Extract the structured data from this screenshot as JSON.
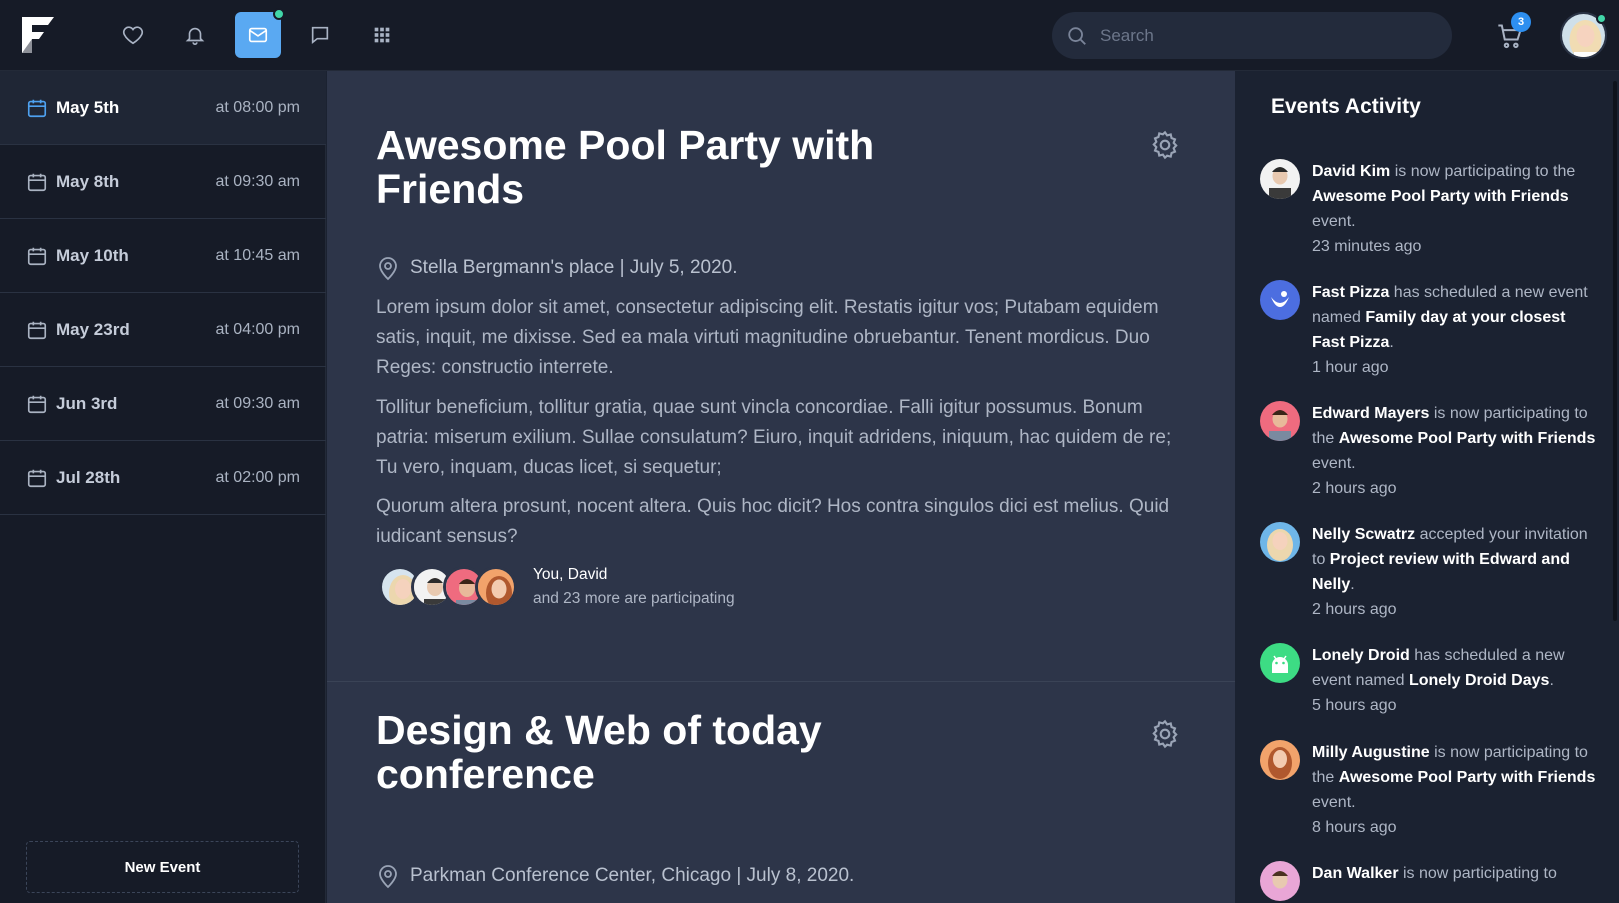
{
  "header": {
    "search_placeholder": "Search",
    "cart_count": "3"
  },
  "sidebar": {
    "dates": [
      {
        "label": "May 5th",
        "time": "at 08:00 pm"
      },
      {
        "label": "May 8th",
        "time": "at 09:30 am"
      },
      {
        "label": "May 10th",
        "time": "at 10:45 am"
      },
      {
        "label": "May 23rd",
        "time": "at 04:00 pm"
      },
      {
        "label": "Jun 3rd",
        "time": "at 09:30 am"
      },
      {
        "label": "Jul 28th",
        "time": "at 02:00 pm"
      }
    ],
    "new_event_label": "New Event"
  },
  "events": [
    {
      "title": "Awesome Pool Party with Friends",
      "location": "Stella Bergmann's place | July 5, 2020.",
      "paragraphs": [
        "Lorem ipsum dolor sit amet, consectetur adipiscing elit. Restatis igitur vos; Putabam equidem satis, inquit, me dixisse. Sed ea mala virtuti magnitudine obruebantur. Tenent mordicus. Duo Reges: constructio interrete.",
        "Tollitur beneficium, tollitur gratia, quae sunt vincla concordiae. Falli igitur possumus. Bonum patria: miserum exilium. Sullae consulatum? Eiuro, inquit adridens, iniquum, hac quidem de re; Tu vero, inquam, ducas licet, si sequetur;",
        "Quorum altera prosunt, nocent altera. Quis hoc dicit? Hos contra singulos dici est melius. Quid iudicant sensus?"
      ],
      "participants_names": "You, David",
      "participants_more": "and 23 more are participating"
    },
    {
      "title": "Design & Web of today conference",
      "location": "Parkman Conference Center, Chicago | July 8, 2020."
    }
  ],
  "activity": {
    "title": "Events Activity",
    "items": [
      {
        "actor": "David Kim",
        "verb": " is now participating to the ",
        "target": "Awesome Pool Party with Friends",
        "tail": " event.",
        "time": "23 minutes ago"
      },
      {
        "actor": "Fast Pizza",
        "verb": " has scheduled a new event named ",
        "target": "Family day at your closest Fast Pizza",
        "tail": ".",
        "time": "1 hour ago"
      },
      {
        "actor": "Edward Mayers",
        "verb": " is now participating to the ",
        "target": "Awesome Pool Party with Friends",
        "tail": " event.",
        "time": "2 hours ago"
      },
      {
        "actor": "Nelly Scwatrz",
        "verb": " accepted your invitation to ",
        "target": "Project review with Edward and Nelly",
        "tail": ".",
        "time": "2 hours ago"
      },
      {
        "actor": "Lonely Droid",
        "verb": " has scheduled a new event named ",
        "target": "Lonely Droid Days",
        "tail": ".",
        "time": "5 hours ago"
      },
      {
        "actor": "Milly Augustine",
        "verb": " is now participating to the ",
        "target": "Awesome Pool Party with Friends",
        "tail": " event.",
        "time": "8 hours ago"
      },
      {
        "actor": "Dan Walker",
        "verb": " is now participating to",
        "target": "",
        "tail": "",
        "time": ""
      }
    ]
  },
  "colors": {
    "accent": "#5aa9f2",
    "online": "#41d6a8",
    "badge": "#2d8ff0"
  },
  "icons": [
    "logo-icon",
    "heart-icon",
    "bell-icon",
    "mail-icon",
    "chat-icon",
    "apps-grid-icon",
    "search-icon",
    "cart-icon",
    "calendar-icon",
    "gear-icon",
    "map-pin-icon"
  ]
}
